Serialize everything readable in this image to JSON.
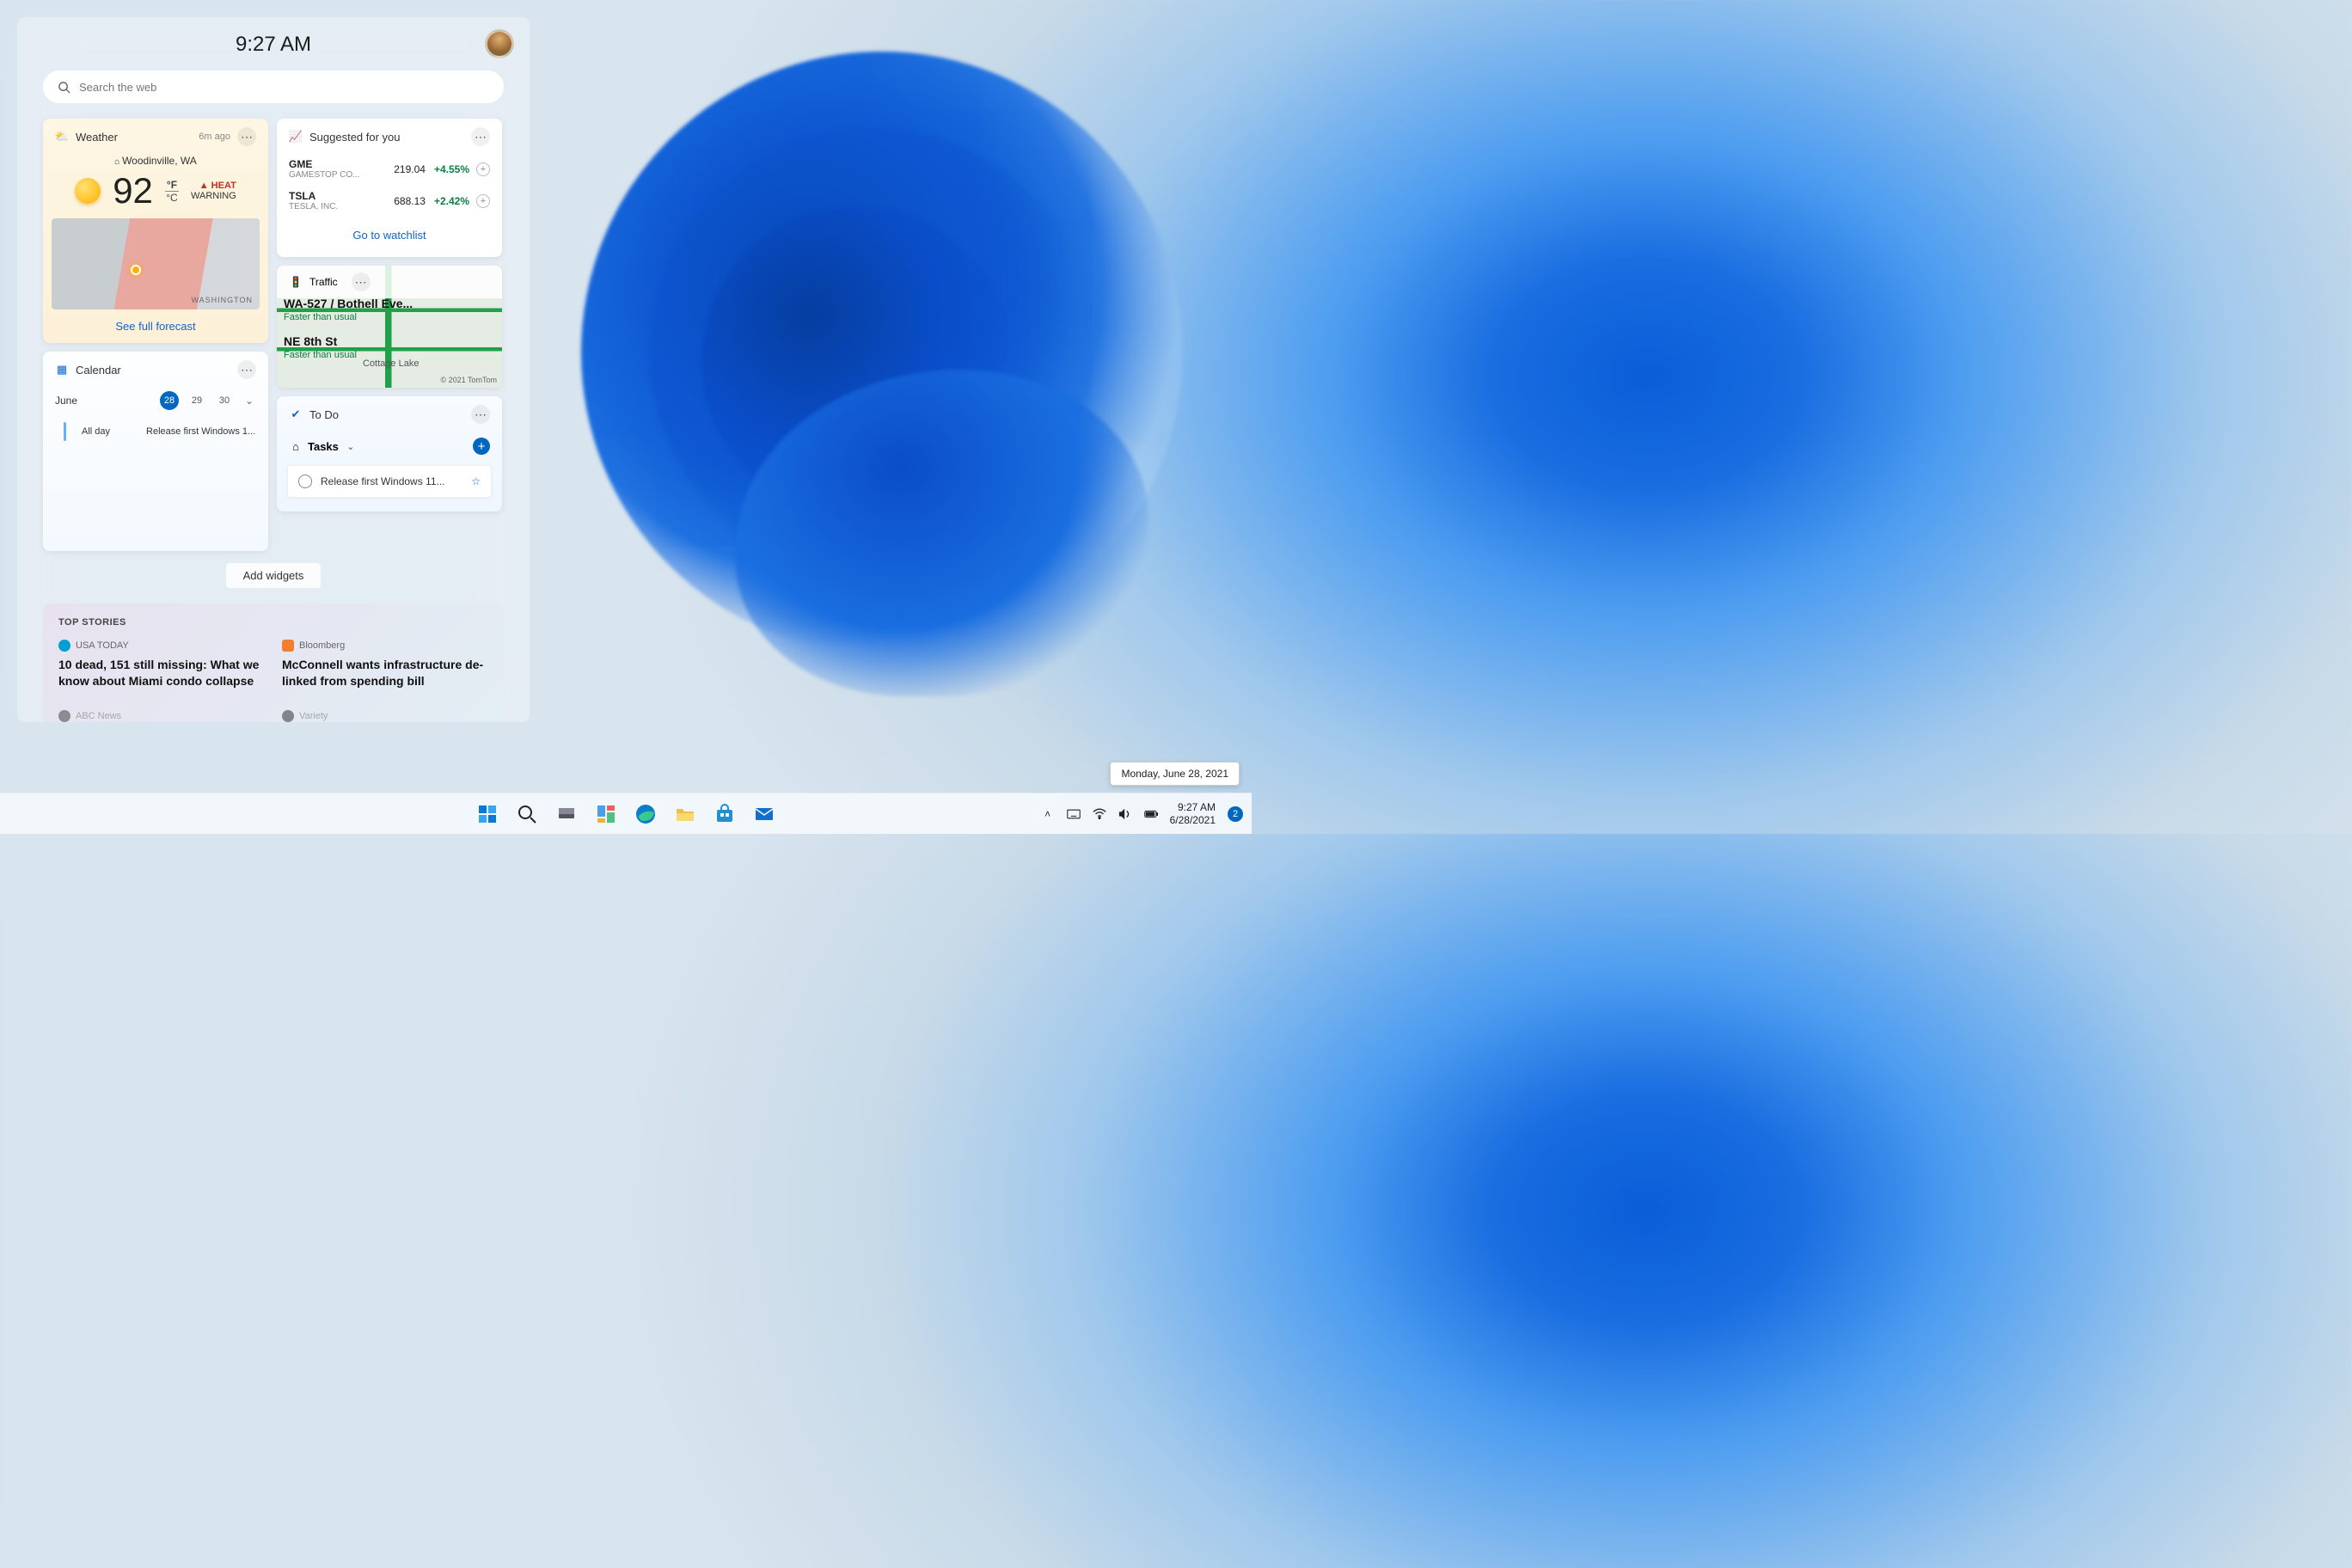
{
  "panel": {
    "time": "9:27 AM",
    "search_placeholder": "Search the web"
  },
  "weather": {
    "title": "Weather",
    "age": "6m ago",
    "location": "Woodinville, WA",
    "temp": "92",
    "unit_f": "°F",
    "unit_c": "°C",
    "alert_prefix": "▲",
    "alert_line1": "HEAT",
    "alert_line2": "WARNING",
    "region": "WASHINGTON",
    "forecast_link": "See full forecast"
  },
  "calendar": {
    "title": "Calendar",
    "month": "June",
    "days": [
      "28",
      "29",
      "30"
    ],
    "allday": "All day",
    "event": "Release first Windows 1..."
  },
  "stocks": {
    "title": "Suggested for you",
    "items": [
      {
        "sym": "GME",
        "co": "GAMESTOP CO...",
        "price": "219.04",
        "chg": "+4.55%"
      },
      {
        "sym": "TSLA",
        "co": "TESLA, INC.",
        "price": "688.13",
        "chg": "+2.42%"
      }
    ],
    "link": "Go to watchlist"
  },
  "traffic": {
    "title": "Traffic",
    "road": "WA-527 / Bothell Eve...",
    "status1": "Faster than usual",
    "road2": "NE 8th St",
    "status2": "Faster than usual",
    "place": "Cottage Lake",
    "copyright": "© 2021 TomTom"
  },
  "todo": {
    "title": "To Do",
    "section": "Tasks",
    "item": "Release first Windows 11..."
  },
  "add_widgets": "Add widgets",
  "topstories": {
    "head": "TOP STORIES",
    "a_src": "USA TODAY",
    "a_title": "10 dead, 151 still missing: What we know about Miami condo collapse",
    "b_src": "Bloomberg",
    "b_title": "McConnell wants infrastructure de-linked from spending bill",
    "c_src": "ABC News",
    "d_src": "Variety"
  },
  "tooltip": "Monday, June 28, 2021",
  "taskbar": {
    "time": "9:27 AM",
    "date": "6/28/2021",
    "notif": "2"
  }
}
